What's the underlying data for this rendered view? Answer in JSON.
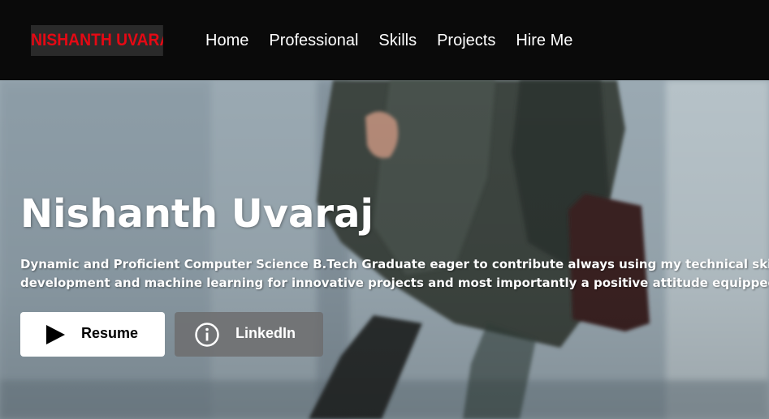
{
  "brand": {
    "logo_text": "NISHANTH UVARAJ",
    "accent_color": "#e50914"
  },
  "nav": {
    "links": [
      {
        "label": "Home"
      },
      {
        "label": "Professional"
      },
      {
        "label": "Skills"
      },
      {
        "label": "Projects"
      },
      {
        "label": "Hire Me"
      }
    ]
  },
  "hero": {
    "title": "Nishanth Uvaraj",
    "description_line1": "Dynamic and Proficient Computer Science B.Tech Graduate eager to contribute always using my technical skills and",
    "description_line2": "development and machine learning for innovative projects and most importantly a positive attitude equipped with",
    "buttons": {
      "resume": {
        "label": "Resume",
        "icon": "play-icon"
      },
      "linkedin": {
        "label": "LinkedIn",
        "icon": "info-icon"
      }
    }
  }
}
